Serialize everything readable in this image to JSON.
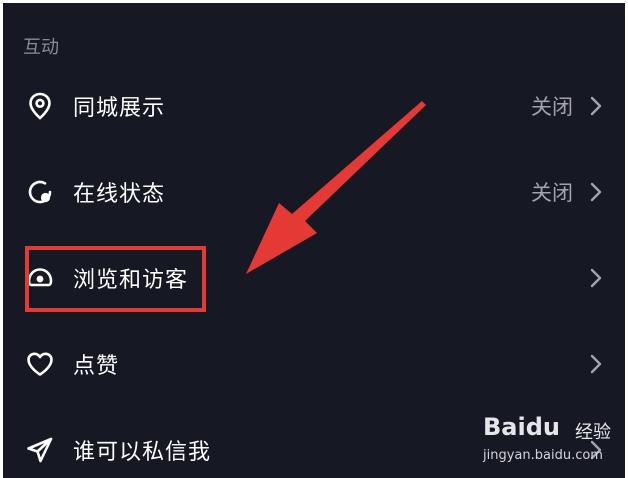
{
  "section": {
    "title": "互动"
  },
  "rows": [
    {
      "label": "同城展示",
      "value": "关闭",
      "icon": "location-pin-icon"
    },
    {
      "label": "在线状态",
      "value": "关闭",
      "icon": "online-status-icon"
    },
    {
      "label": "浏览和访客",
      "value": "",
      "icon": "eye-icon"
    },
    {
      "label": "点赞",
      "value": "",
      "icon": "heart-icon"
    },
    {
      "label": "谁可以私信我",
      "value": "",
      "icon": "send-icon"
    }
  ],
  "watermark": {
    "logo": "Baidu",
    "brand": "经验",
    "url": "jingyan.baidu.com"
  },
  "colors": {
    "background": "#161823",
    "text": "#ffffff",
    "muted": "#a3a4aa",
    "highlight": "#e53935"
  }
}
